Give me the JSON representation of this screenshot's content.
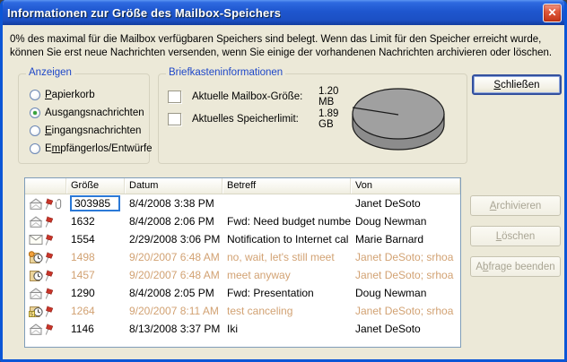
{
  "window": {
    "title": "Informationen zur Größe des Mailbox-Speichers",
    "close_glyph": "✕"
  },
  "intro": "0% des maximal für die Mailbox verfügbaren Speichers sind belegt. Wenn das Limit für den Speicher erreicht wurde, können Sie erst neue Nachrichten versenden, wenn Sie einige der vorhandenen Nachrichten archivieren oder löschen.",
  "anzeigen": {
    "title": "Anzeigen",
    "options": [
      {
        "name": "trash",
        "label": "Papierkorb",
        "accel": 0,
        "selected": false
      },
      {
        "name": "outbox",
        "label": "Ausgangsnachrichten",
        "accel": 3,
        "selected": true
      },
      {
        "name": "inbox",
        "label": "Eingangsnachrichten",
        "accel": 0,
        "selected": false
      },
      {
        "name": "no-recipient-drafts",
        "label": "Empfängerlos/Entwürfe",
        "accel": 1,
        "selected": false
      }
    ]
  },
  "briefkasten": {
    "title": "Briefkasteninformationen",
    "legend": [
      {
        "name": "current-mailbox-size",
        "color": "#0000F0",
        "label": "Aktuelle Mailbox-Größe:",
        "value": "1.20 MB"
      },
      {
        "name": "current-storage-limit",
        "color": "#A3A3A3",
        "label": "Aktuelles Speicherlimit:",
        "value": "1.89 GB"
      }
    ],
    "pie": {
      "type": "pie",
      "percent_used": "0%",
      "used_color": "#0000F0",
      "free_color": "#A0A0A0"
    }
  },
  "close_button": {
    "label": "Schließen",
    "accel": 0
  },
  "table": {
    "columns": [
      "",
      "Größe",
      "Datum",
      "Betreff",
      "Von"
    ],
    "rows": [
      {
        "icons": [
          "mail-read",
          "flag",
          "paperclip"
        ],
        "size": "303985",
        "date": "8/4/2008 3:38 PM",
        "subject": "",
        "from": "Janet DeSoto",
        "muted": false,
        "editing": true
      },
      {
        "icons": [
          "mail-read",
          "flag"
        ],
        "size": "1632",
        "date": "8/4/2008 2:06 PM",
        "subject": "Fwd: Need budget numbe",
        "from": "Doug Newman",
        "muted": false,
        "editing": false
      },
      {
        "icons": [
          "mail-unread",
          "flag"
        ],
        "size": "1554",
        "date": "2/29/2008 3:06 PM",
        "subject": "Notification to Internet cal",
        "from": "Marie Barnard",
        "muted": false,
        "editing": false
      },
      {
        "icons": [
          "meeting-orange",
          "flag"
        ],
        "size": "1498",
        "date": "9/20/2007 6:48 AM",
        "subject": "no, wait, let's still meet",
        "from": "Janet DeSoto;  srhoa",
        "muted": true,
        "editing": false
      },
      {
        "icons": [
          "meeting",
          "flag"
        ],
        "size": "1457",
        "date": "9/20/2007 6:48 AM",
        "subject": "meet anyway",
        "from": "Janet DeSoto;  srhoa",
        "muted": true,
        "editing": false
      },
      {
        "icons": [
          "mail-read",
          "flag"
        ],
        "size": "1290",
        "date": "8/4/2008 2:05 PM",
        "subject": "Fwd: Presentation",
        "from": "Doug Newman",
        "muted": false,
        "editing": false
      },
      {
        "icons": [
          "meeting-cancel",
          "flag"
        ],
        "size": "1264",
        "date": "9/20/2007 8:11 AM",
        "subject": "test canceling",
        "from": "Janet DeSoto;  srhoa",
        "muted": true,
        "editing": false
      },
      {
        "icons": [
          "mail-read",
          "flag"
        ],
        "size": "1146",
        "date": "8/13/2008 3:37 PM",
        "subject": "Iki",
        "from": "Janet DeSoto",
        "muted": false,
        "editing": false
      }
    ]
  },
  "side_buttons": [
    {
      "name": "archive-button",
      "label": "Archivieren",
      "accel": 0,
      "disabled": true
    },
    {
      "name": "delete-button",
      "label": "Löschen",
      "accel": 0,
      "disabled": true
    },
    {
      "name": "end-query-button",
      "label": "Abfrage beenden",
      "accel": 1,
      "disabled": true
    }
  ]
}
